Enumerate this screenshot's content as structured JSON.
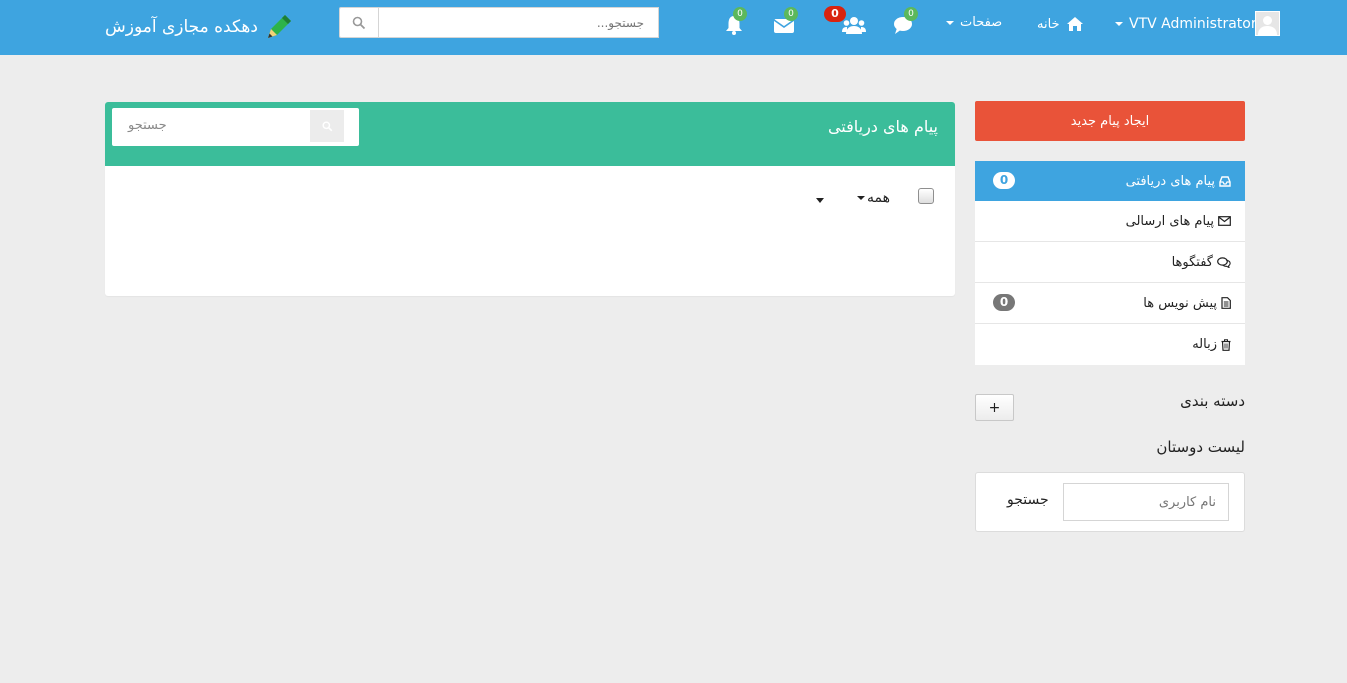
{
  "navbar": {
    "brand": "دهکده مجازی آموزش",
    "search": {
      "placeholder": "جستجو..."
    },
    "notifications": {
      "count": "0"
    },
    "messages": {
      "count": "0"
    },
    "friend_requests": {
      "count": "0"
    },
    "chats": {
      "count": "0"
    },
    "pages_label": "صفحات",
    "home_label": "خانه",
    "user_label": "VTV Administrator"
  },
  "panel": {
    "title": "پیام های دریافتی",
    "search_placeholder": "جستجو",
    "filter_label": "همه"
  },
  "sidebar": {
    "new_message": "ایجاد پیام جدید",
    "folders": [
      {
        "label": "پیام های دریافتی",
        "badge": "0",
        "icon": "inbox-icon"
      },
      {
        "label": "پیام های ارسالی",
        "icon": "envelope-icon"
      },
      {
        "label": "گفتگوها",
        "icon": "comments-icon"
      },
      {
        "label": "پیش نویس ها",
        "badge": "0",
        "icon": "draft-icon"
      },
      {
        "label": "زباله",
        "icon": "trash-icon"
      }
    ],
    "categories_label": "دسته بندی",
    "add_label": "+",
    "friends_label": "لیست دوستان",
    "friends_input_placeholder": "نام کاربری",
    "friends_search_label": "جستجو"
  },
  "colors": {
    "navbar": "#3ea4e0",
    "panel_header": "#3bbd9a",
    "new_message": "#e95339",
    "badge_red": "#d9230f",
    "badge_green": "#5cb85c"
  }
}
